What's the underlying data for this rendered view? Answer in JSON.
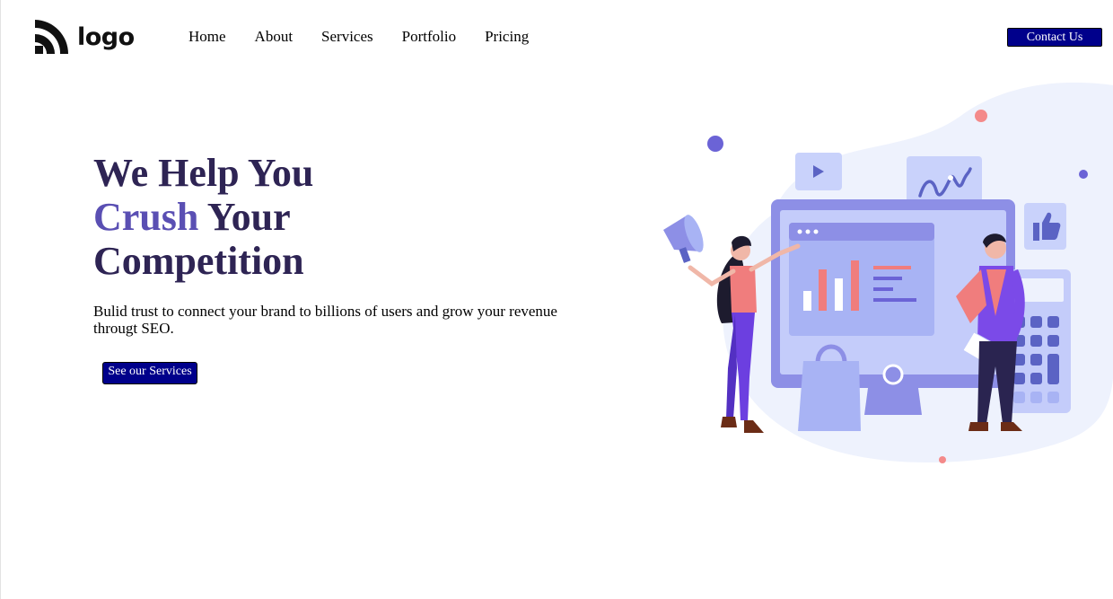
{
  "header": {
    "logo_text": "logo",
    "nav": [
      "Home",
      "About",
      "Services",
      "Portfolio",
      "Pricing"
    ],
    "contact_label": "Contact Us"
  },
  "hero": {
    "title_line1": "We Help You",
    "title_accent": "Crush",
    "title_line2_rest": " Your",
    "title_line3": "Competition",
    "subtitle": "Bulid trust to connect your brand to billions of users and grow your revenue througt SEO.",
    "cta_label": "See our Services"
  },
  "colors": {
    "button_bg": "#00008b",
    "heading": "#2e2454",
    "accent": "#5a4fb3"
  },
  "icons": [
    "logo-mark-icon",
    "megaphone-icon",
    "play-icon",
    "wave-chart-icon",
    "thumbs-up-icon"
  ]
}
